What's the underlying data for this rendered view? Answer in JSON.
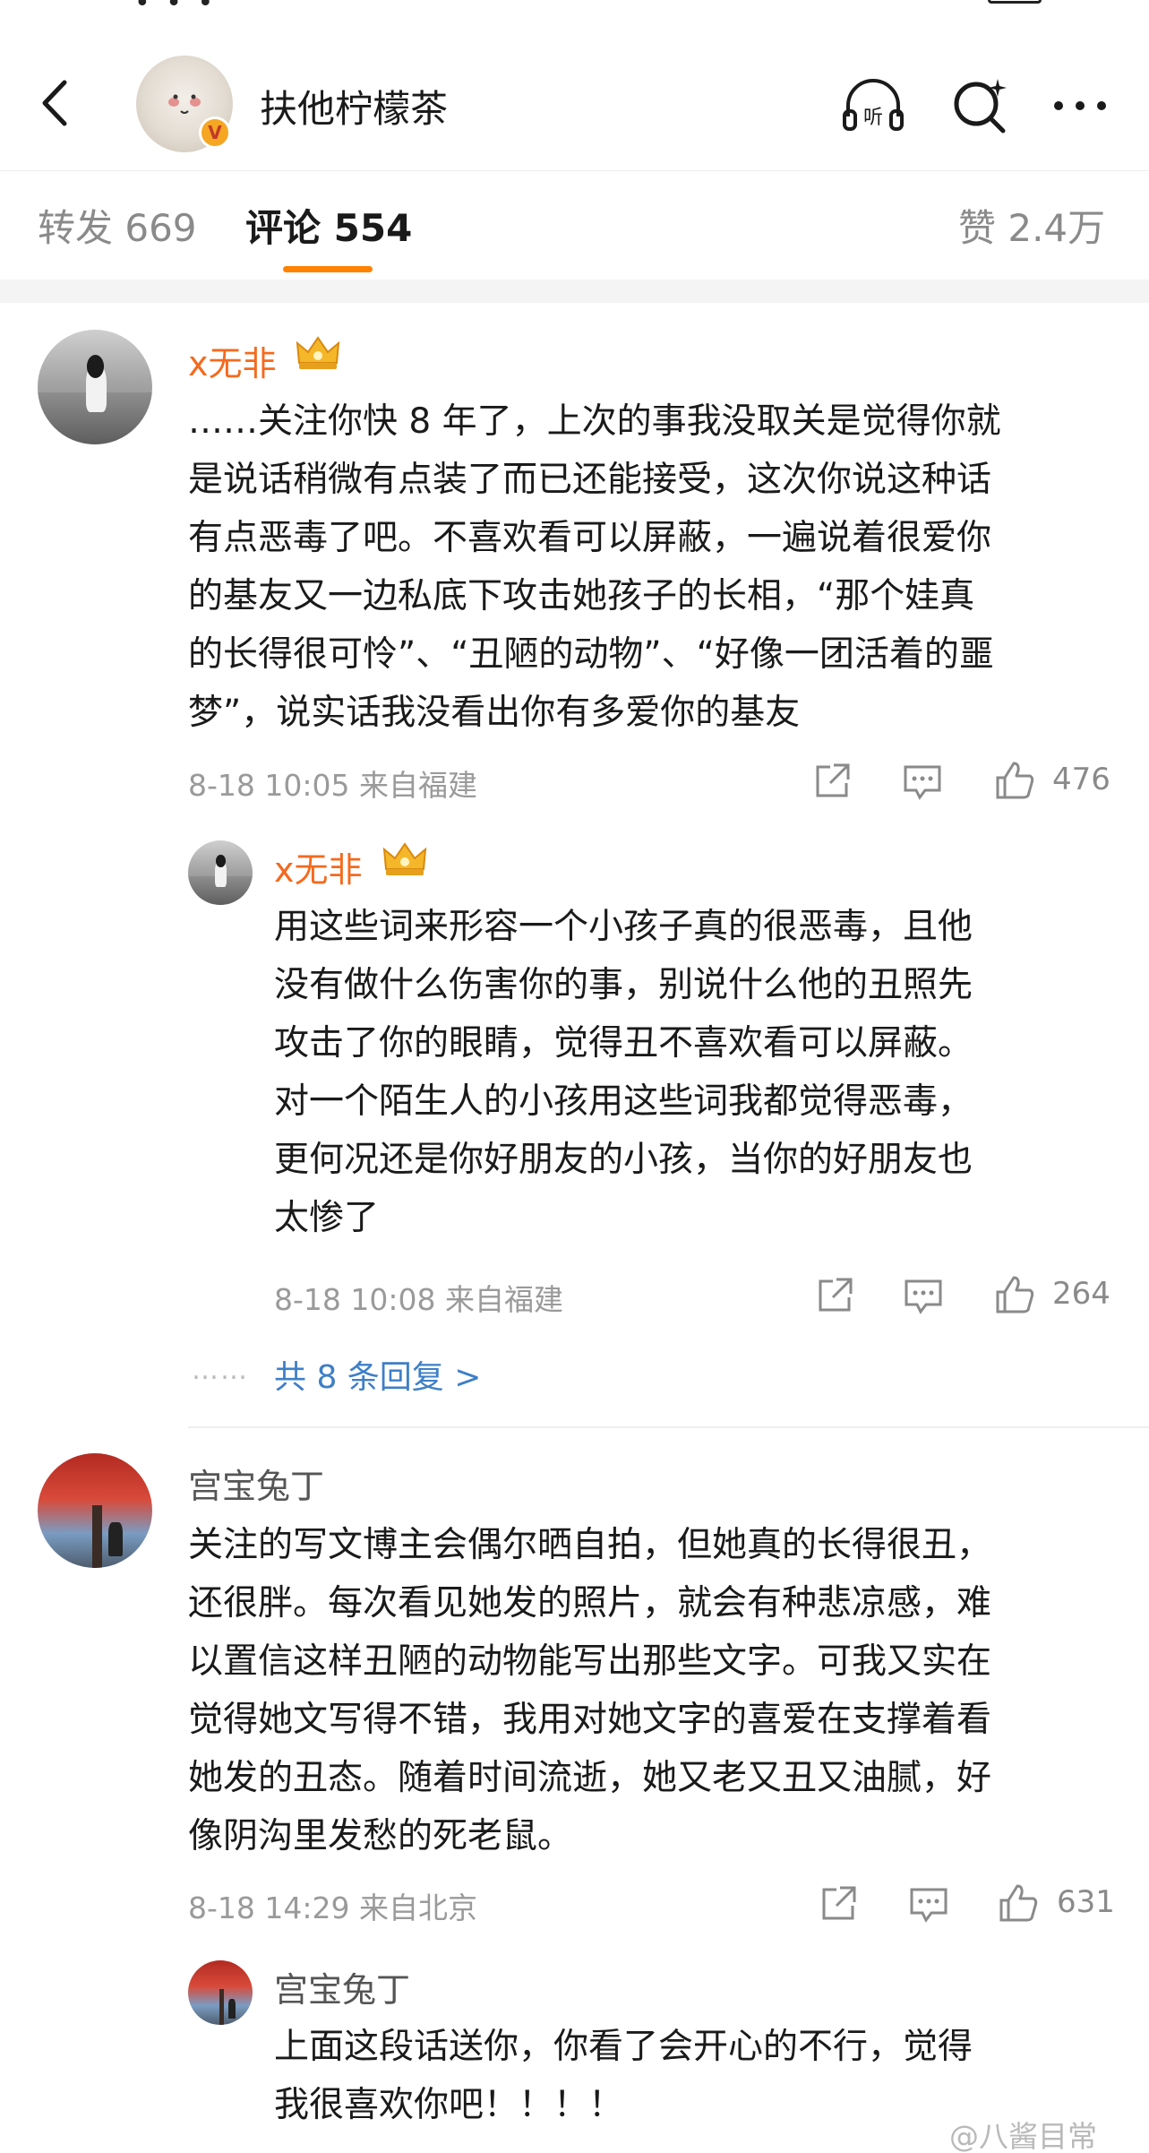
{
  "header": {
    "title": "扶他柠檬茶",
    "badge": "V"
  },
  "tabs": [
    {
      "label": "转发 669"
    },
    {
      "label": "评论 554"
    },
    {
      "label": "赞 2.4万"
    }
  ],
  "comments": [
    {
      "user": "x无非",
      "lines": [
        "……关注你快 8 年了，上次的事我没取关是觉得你就",
        "是说话稍微有点装了而已还能接受，这次你说这种话",
        "有点恶毒了吧。不喜欢看可以屏蔽，一遍说着很爱你",
        "的基友又一边私底下攻击她孩子的长相，“那个娃真",
        "的长得很可怜”、“丑陋的动物”、“好像一团活着的噩",
        "梦”，说实话我没看出你有多爱你的基友"
      ],
      "meta": "8-18 10:05  来自福建",
      "likes": "476",
      "reply": {
        "user": "x无非",
        "lines": [
          "用这些词来形容一个小孩子真的很恶毒，且他",
          "没有做什么伤害你的事，别说什么他的丑照先",
          "攻击了你的眼睛，觉得丑不喜欢看可以屏蔽。",
          "对一个陌生人的小孩用这些词我都觉得恶毒，",
          "更何况还是你好朋友的小孩，当你的好朋友也",
          "太惨了"
        ],
        "meta": "8-18 10:08  来自福建",
        "likes": "264"
      },
      "more_replies": "共 8 条回复 >",
      "more_dots": "……"
    },
    {
      "user": "宫宝兔丁",
      "lines": [
        "关注的写文博主会偶尔晒自拍，但她真的长得很丑，",
        "还很胖。每次看见她发的照片，就会有种悲凉感，难",
        "以置信这样丑陋的动物能写出那些文字。可我又实在",
        "觉得她文写得不错，我用对她文字的喜爱在支撑着看",
        "她发的丑态。随着时间流逝，她又老又丑又油腻，好",
        "像阴沟里发愁的死老鼠。"
      ],
      "meta": "8-18 14:29  来自北京",
      "likes": "631",
      "reply": {
        "user": "宫宝兔丁",
        "lines": [
          "上面这段话送你，你看了会开心的不行，觉得",
          "我很喜欢你吧！！！！"
        ]
      }
    }
  ],
  "watermark": "@八酱目常",
  "colors": {
    "accent": "#ff8200",
    "username": "#f46a1e",
    "link": "#3e7fc7"
  },
  "icons": [
    "back-arrow-icon",
    "listen-headphone-icon",
    "search-sparkle-icon",
    "more-dots-icon",
    "share-icon",
    "comment-icon",
    "like-thumb-icon",
    "crown-icon"
  ]
}
